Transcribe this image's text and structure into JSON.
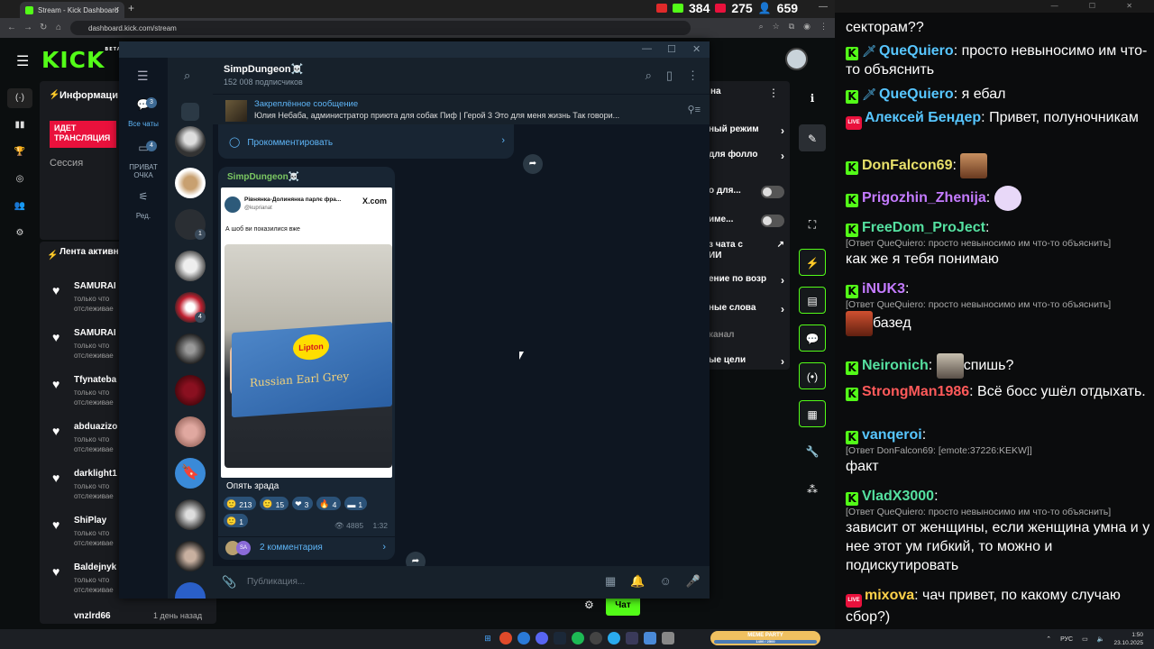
{
  "browser": {
    "tab_title": "Stream - Kick Dashboard",
    "url": "dashboard.kick.com/stream",
    "stats": {
      "youtube": "",
      "kick": "384",
      "vk": "275",
      "viewers": "659"
    }
  },
  "kick": {
    "logo": "KICK",
    "logo_sup": "BETA",
    "info_title": "Информаци",
    "live_badge": "ИДЕТ ТРАНСЛЯЦИЯ",
    "session": "Сессия",
    "feed_title": "Лента активности",
    "feed": [
      {
        "name": "SAMURAI",
        "sub1": "только что",
        "sub2": "отслеживае"
      },
      {
        "name": "SAMURAI",
        "sub1": "только что",
        "sub2": "отслеживае"
      },
      {
        "name": "Tfynateba",
        "sub1": "только что",
        "sub2": "отслеживае"
      },
      {
        "name": "abduazizo",
        "sub1": "только что",
        "sub2": "отслеживае"
      },
      {
        "name": "darklight1",
        "sub1": "только что",
        "sub2": "отслеживае"
      },
      {
        "name": "ShiPlay",
        "sub1": "только что",
        "sub2": "отслеживае"
      },
      {
        "name": "Baldejnyk",
        "sub1": "только что",
        "sub2": "отслеживае"
      }
    ],
    "feed_last": "vnzlrd66",
    "feed_last_time": "1 день назад",
    "settings_title": "на",
    "settings": [
      {
        "label": "ный режим",
        "control": "chevron"
      },
      {
        "label": "для фолло",
        "control": "chevron"
      },
      {
        "label": "о для...",
        "control": "toggle"
      },
      {
        "label": "име...",
        "control": "toggle"
      },
      {
        "label": "з чата с",
        "control": "ext"
      },
      {
        "label": "ИИ",
        "control": "none"
      },
      {
        "label": "ение по возр",
        "control": "chevron"
      },
      {
        "label": "ные слова",
        "control": "chevron"
      },
      {
        "label": "канал",
        "control": "none"
      },
      {
        "label": "ые цели",
        "control": "chevron"
      }
    ],
    "chat_button": "Чат"
  },
  "telegram": {
    "channel_name": "SimpDungeon☠️",
    "subscribers": "152 008 подписчиков",
    "folders": [
      {
        "label": "Все чаты",
        "badge": "3"
      },
      {
        "label": "ПРИВАТ ОЧКА",
        "badge": "4"
      },
      {
        "label": "Ред.",
        "badge": ""
      }
    ],
    "chat_badges": [
      "1",
      "4"
    ],
    "pinned_title": "Закреплённое сообщение",
    "pinned_text": "Юлия Небаба, администратор приюта для собак Пиф | Герой 3  Это для меня жизнь  Так говори...",
    "prev_comment_label": "Прокомментировать",
    "post": {
      "author": "SimpDungeon☠️",
      "tweet_name": "Рівнянка-Долинянка парлє фра...",
      "tweet_handle": "@kuprianat",
      "tweet_source": "X.com",
      "tweet_text": "А шоб ви показилися вже",
      "photo_brand": "Lipton",
      "photo_product": "Russian Earl Grey",
      "caption": "Опять зрада",
      "reactions": [
        {
          "emoji": "🙂",
          "count": "213"
        },
        {
          "emoji": "🙂",
          "count": "15"
        },
        {
          "emoji": "❤",
          "count": "3"
        },
        {
          "emoji": "🔥",
          "count": "4"
        },
        {
          "emoji": "▬",
          "count": "1"
        },
        {
          "emoji": "🙂",
          "count": "1"
        }
      ],
      "views": "4885",
      "time": "1:32",
      "comments_label": "2 комментария"
    },
    "composer_placeholder": "Публикация..."
  },
  "chat": {
    "messages": [
      {
        "text": "секторам??"
      },
      {
        "badge": "kick",
        "sword": true,
        "user": "QueQuiero",
        "color": "#57c6ff",
        "text": "просто невыносимо им что-то объяснить"
      },
      {
        "badge": "kick",
        "sword": true,
        "user": "QueQuiero",
        "color": "#57c6ff",
        "text": "я ебал"
      },
      {
        "badge": "live",
        "user": "Алексей Бендер",
        "color": "#57c6ff",
        "text": "Привет, полуночникам"
      },
      {
        "badge": "kick",
        "user": "DonFalcon69",
        "color": "#e8e06a",
        "text": ""
      },
      {
        "badge": "kick",
        "user": "Prigozhin_Zhenija",
        "color": "#c47bff",
        "text": ""
      },
      {
        "badge": "kick",
        "user": "FreeDom_ProJect",
        "color": "#55e0a0",
        "reply": "[Ответ QueQuiero: просто невыносимо им что-то объяснить]",
        "text": "как же я тебя понимаю"
      },
      {
        "badge": "kick",
        "user": "iNUK3",
        "color": "#c47bff",
        "reply": "[Ответ QueQuiero: просто невыносимо им что-то объяснить]",
        "text": "базед"
      },
      {
        "badge": "kick",
        "user": "Neironich",
        "color": "#55e0a0",
        "text": "спишь?"
      },
      {
        "badge": "kick",
        "user": "StrongMan1986",
        "color": "#ff5a5a",
        "text": "Всё босс ушёл отдыхать."
      },
      {
        "badge": "kick",
        "user": "vanqeroi",
        "color": "#57c6ff",
        "reply": "[Ответ DonFalcon69: [emote:37226:KEKW]]",
        "text": "факт"
      },
      {
        "badge": "kick",
        "user": "VladX3000",
        "color": "#55e0a0",
        "reply": "[Ответ QueQuiero: просто невыносимо им что-то объяснить]",
        "text": "зависит от женщины, если женщина умна и у нее этот ум гибкий, то можно и подискутировать"
      },
      {
        "badge": "live",
        "user": "mixova",
        "color": "#ffd24a",
        "text": "чач привет, по какому случаю сбор?)"
      }
    ]
  },
  "taskbar": {
    "meme_title": "MEME PARTY",
    "meme_progress": "1400 / 2500",
    "lang": "РУС",
    "time": "1:50",
    "date": "23.10.2025"
  }
}
